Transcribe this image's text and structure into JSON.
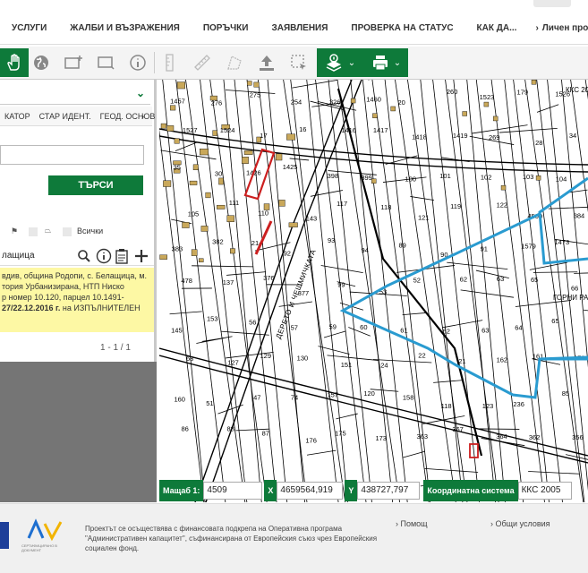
{
  "nav": {
    "items": [
      "УСЛУГИ",
      "ЖАЛБИ И ВЪЗРАЖЕНИЯ",
      "ПОРЪЧКИ",
      "ЗАЯВЛЕНИЯ",
      "ПРОВЕРКА НА СТАТУС",
      "КАК ДА..."
    ],
    "personal": "Личен проф"
  },
  "toolbar": {
    "icons": [
      "hand-pan-icon",
      "globe-icon",
      "add-rectangle-icon",
      "screen-icon",
      "info-icon",
      "ruler-v-icon",
      "ruler-icon",
      "area-measure-icon",
      "upload-icon",
      "select-icon",
      "layers-icon",
      "print-icon"
    ]
  },
  "panel": {
    "tabs": [
      "КАТОР",
      "СТАР ИДЕНТ.",
      "ГЕОД. ОСНОВ"
    ],
    "search_label": "ТЪРСИ",
    "filter_all": "Всички",
    "results_query": "лащица",
    "result_lines": [
      "вдив, община Родопи, с. Белащица, м.",
      "тория Урбанизирана, НТП Ниско",
      "р номер 10.120, парцел 10.1491-"
    ],
    "result_bold": "27/22.12.2016 г.",
    "result_tail": " на ИЗПЪЛНИТЕЛЕН",
    "pager": "1 - 1 / 1"
  },
  "map": {
    "road_label": "ДЕРЕТО И ЧЕШМИЧКАТА",
    "area_label": "ГОРНИ РАНТИ",
    "kks_label": "ККС 20",
    "parcel_numbers": [
      {
        "t": "1457"
      },
      {
        "t": "276"
      },
      {
        "t": "275"
      },
      {
        "t": "254"
      },
      {
        "t": "326"
      },
      {
        "t": "1460"
      },
      {
        "t": "20"
      },
      {
        "t": "260"
      },
      {
        "t": "1523"
      },
      {
        "t": "179"
      },
      {
        "t": "1526"
      },
      {
        "t": "1527"
      },
      {
        "t": "1524"
      },
      {
        "t": "17"
      },
      {
        "t": "16"
      },
      {
        "t": "1416"
      },
      {
        "t": "1417"
      },
      {
        "t": "1418"
      },
      {
        "t": "1419"
      },
      {
        "t": "269"
      },
      {
        "t": "28"
      },
      {
        "t": "34"
      },
      {
        "t": "35"
      },
      {
        "t": "30"
      },
      {
        "t": "1426"
      },
      {
        "t": "1425"
      },
      {
        "t": "398"
      },
      {
        "t": "399"
      },
      {
        "t": "100"
      },
      {
        "t": "101"
      },
      {
        "t": "102"
      },
      {
        "t": "103"
      },
      {
        "t": "104"
      },
      {
        "t": "105"
      },
      {
        "t": "111"
      },
      {
        "t": "110"
      },
      {
        "t": "143"
      },
      {
        "t": "117"
      },
      {
        "t": "118"
      },
      {
        "t": "121"
      },
      {
        "t": "119"
      },
      {
        "t": "122"
      },
      {
        "t": "4500"
      },
      {
        "t": "384"
      },
      {
        "t": "383"
      },
      {
        "t": "382"
      },
      {
        "t": "214"
      },
      {
        "t": "92"
      },
      {
        "t": "93"
      },
      {
        "t": "94"
      },
      {
        "t": "89"
      },
      {
        "t": "90"
      },
      {
        "t": "91"
      },
      {
        "t": "1579"
      },
      {
        "t": "1473"
      },
      {
        "t": "478"
      },
      {
        "t": "137"
      },
      {
        "t": "376"
      },
      {
        "t": "377"
      },
      {
        "t": "99"
      },
      {
        "t": "53"
      },
      {
        "t": "52"
      },
      {
        "t": "62"
      },
      {
        "t": "63"
      },
      {
        "t": "65"
      },
      {
        "t": "66"
      },
      {
        "t": "145"
      },
      {
        "t": "153"
      },
      {
        "t": "56"
      },
      {
        "t": "57"
      },
      {
        "t": "59"
      },
      {
        "t": "60"
      },
      {
        "t": "61"
      },
      {
        "t": "62"
      },
      {
        "t": "63"
      },
      {
        "t": "64"
      },
      {
        "t": "65"
      },
      {
        "t": "68"
      },
      {
        "t": "127"
      },
      {
        "t": "129"
      },
      {
        "t": "130"
      },
      {
        "t": "151"
      },
      {
        "t": "24"
      },
      {
        "t": "22"
      },
      {
        "t": "21"
      },
      {
        "t": "162"
      },
      {
        "t": "161"
      },
      {
        "t": "179"
      },
      {
        "t": "160"
      },
      {
        "t": "51"
      },
      {
        "t": "47"
      },
      {
        "t": "74"
      },
      {
        "t": "157"
      },
      {
        "t": "120"
      },
      {
        "t": "158"
      },
      {
        "t": "118"
      },
      {
        "t": "123"
      },
      {
        "t": "236"
      },
      {
        "t": "85"
      },
      {
        "t": "86"
      },
      {
        "t": "88"
      },
      {
        "t": "87"
      },
      {
        "t": "176"
      },
      {
        "t": "175"
      },
      {
        "t": "173"
      },
      {
        "t": "363"
      },
      {
        "t": "367"
      },
      {
        "t": "364"
      },
      {
        "t": "362"
      },
      {
        "t": "356"
      }
    ]
  },
  "coords": {
    "scale_label": "Мащаб 1:",
    "scale_value": "4509",
    "x_label": "X",
    "x_value": "4659564,919",
    "y_label": "Y",
    "y_value": "438727,797",
    "system_label": "Координатна система",
    "system_value": "ККС 2005"
  },
  "footer": {
    "text": "Проектът се осъществява с финансовата подкрепа на Оперативна програма \"Административен капацитет\", съфинансирана от Европейския съюз чрез Европейския социален фонд.",
    "help": "Помощ",
    "terms": "Общи условия",
    "logo_small": "СЕРТИФИЦИРАНО В ДОКУМЕНТ"
  },
  "colors": {
    "green": "#0e7a3a",
    "route": "#2a9bd0",
    "highlight": "#cc1f1f",
    "yellow": "#fdf8a4"
  }
}
